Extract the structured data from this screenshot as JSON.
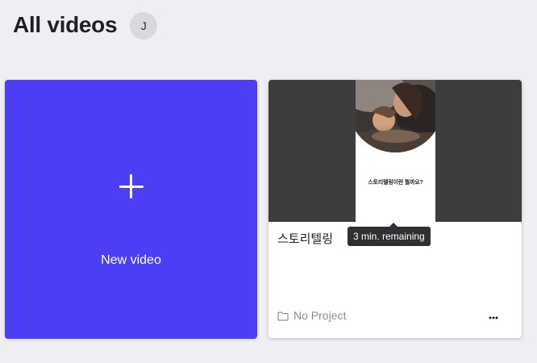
{
  "header": {
    "title": "All videos",
    "avatar_initial": "J"
  },
  "new_video_card": {
    "label": "New video",
    "icon": "plus-icon",
    "background": "#4b3ef5"
  },
  "videos": [
    {
      "title": "스토리텔링",
      "thumbnail_caption": "스토리텔링이란 뭘까요?",
      "tooltip": "3 min. remaining",
      "project": "No Project",
      "project_icon": "folder-icon",
      "menu_icon": "more-icon"
    }
  ]
}
